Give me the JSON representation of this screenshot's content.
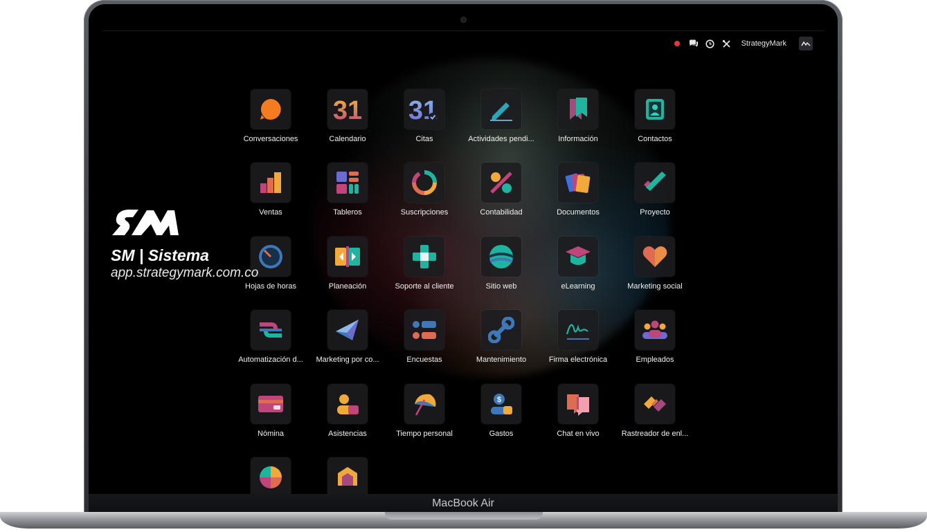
{
  "device": {
    "chin_label": "MacBook Air"
  },
  "navbar": {
    "company": "StrategyMark",
    "icons": [
      "status-dot",
      "chat-icon",
      "clock-icon",
      "tools-icon"
    ]
  },
  "overlay": {
    "title": "SM | Sistema",
    "url": "app.strategymark.com.co"
  },
  "apps": [
    {
      "label": "Conversaciones"
    },
    {
      "label": "Calendario"
    },
    {
      "label": "Citas"
    },
    {
      "label": "Actividades pendi..."
    },
    {
      "label": "Información"
    },
    {
      "label": "Contactos"
    },
    {
      "label": "Ventas"
    },
    {
      "label": "Tableros"
    },
    {
      "label": "Suscripciones"
    },
    {
      "label": "Contabilidad"
    },
    {
      "label": "Documentos"
    },
    {
      "label": "Proyecto"
    },
    {
      "label": "Hojas de horas"
    },
    {
      "label": "Planeación"
    },
    {
      "label": "Soporte al cliente"
    },
    {
      "label": "Sitio web"
    },
    {
      "label": "eLearning"
    },
    {
      "label": "Marketing social"
    },
    {
      "label": "Automatización d..."
    },
    {
      "label": "Marketing por co..."
    },
    {
      "label": "Encuestas"
    },
    {
      "label": "Mantenimiento"
    },
    {
      "label": "Firma electrónica"
    },
    {
      "label": "Empleados"
    },
    {
      "label": "Nómina"
    },
    {
      "label": "Asistencias"
    },
    {
      "label": "Tiempo personal"
    },
    {
      "label": "Gastos"
    },
    {
      "label": "Chat en vivo"
    },
    {
      "label": "Rastreador de enl..."
    }
  ],
  "icon_text": {
    "calendar_day": "31"
  }
}
